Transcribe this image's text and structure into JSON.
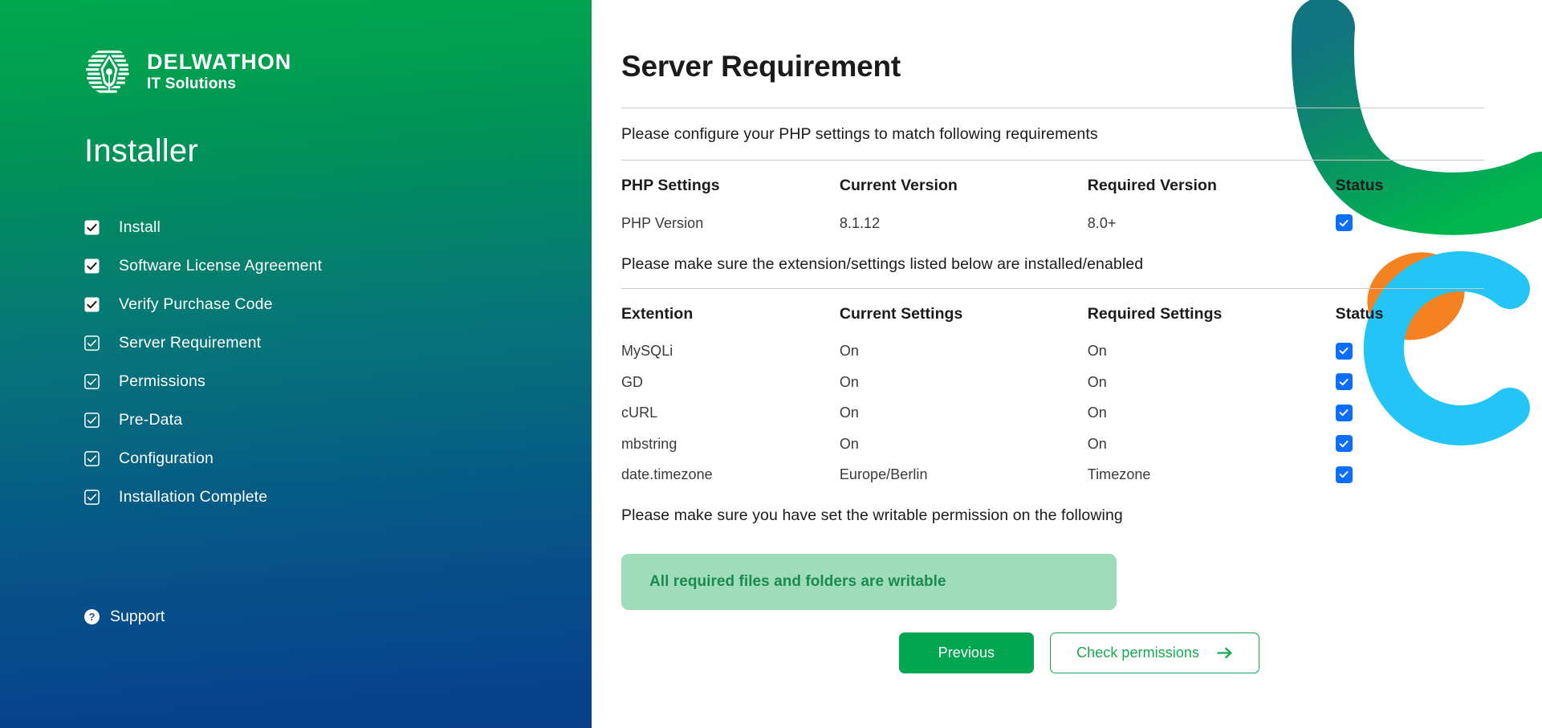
{
  "sidebar": {
    "logo": {
      "name": "DELWATHON",
      "tagline": "IT Solutions",
      "mark": "pen-nib-circle-logo"
    },
    "heading": "Installer",
    "steps": [
      {
        "label": "Install",
        "state": "done"
      },
      {
        "label": "Software License Agreement",
        "state": "done"
      },
      {
        "label": "Verify Purchase Code",
        "state": "done"
      },
      {
        "label": "Server Requirement",
        "state": "current"
      },
      {
        "label": "Permissions",
        "state": "pending"
      },
      {
        "label": "Pre-Data",
        "state": "pending"
      },
      {
        "label": "Configuration",
        "state": "pending"
      },
      {
        "label": "Installation Complete",
        "state": "pending"
      }
    ],
    "support": {
      "label": "Support",
      "icon": "question-circle-icon"
    }
  },
  "main": {
    "title": "Server Requirement",
    "php_note": "Please configure your PHP settings to match following requirements",
    "php_table": {
      "headers": [
        "PHP Settings",
        "Current Version",
        "Required Version",
        "Status"
      ],
      "rows": [
        {
          "name": "PHP Version",
          "current": "8.1.12",
          "required": "8.0+",
          "status": "checked"
        }
      ]
    },
    "ext_note": "Please make sure the extension/settings listed below are installed/enabled",
    "ext_table": {
      "headers": [
        "Extention",
        "Current Settings",
        "Required Settings",
        "Status"
      ],
      "rows": [
        {
          "name": "MySQLi",
          "current": "On",
          "required": "On",
          "status": "checked"
        },
        {
          "name": "GD",
          "current": "On",
          "required": "On",
          "status": "checked"
        },
        {
          "name": "cURL",
          "current": "On",
          "required": "On",
          "status": "checked"
        },
        {
          "name": "mbstring",
          "current": "On",
          "required": "On",
          "status": "checked"
        },
        {
          "name": "date.timezone",
          "current": "Europe/Berlin",
          "required": "Timezone",
          "status": "checked"
        }
      ]
    },
    "writable_note": "Please make sure you have set the writable permission on the following",
    "writable_alert": "All required files and folders are writable",
    "buttons": {
      "previous": "Previous",
      "check_permissions": "Check permissions"
    }
  },
  "colors": {
    "sidebar_top": "#00a84f",
    "sidebar_bottom": "#08408c",
    "status_blue": "#0d6efd",
    "primary_green": "#00a650",
    "alert_bg": "#9fddba",
    "alert_text": "#1a8a4e",
    "deco_orange": "#f58220",
    "deco_cyan": "#22c5f5"
  }
}
